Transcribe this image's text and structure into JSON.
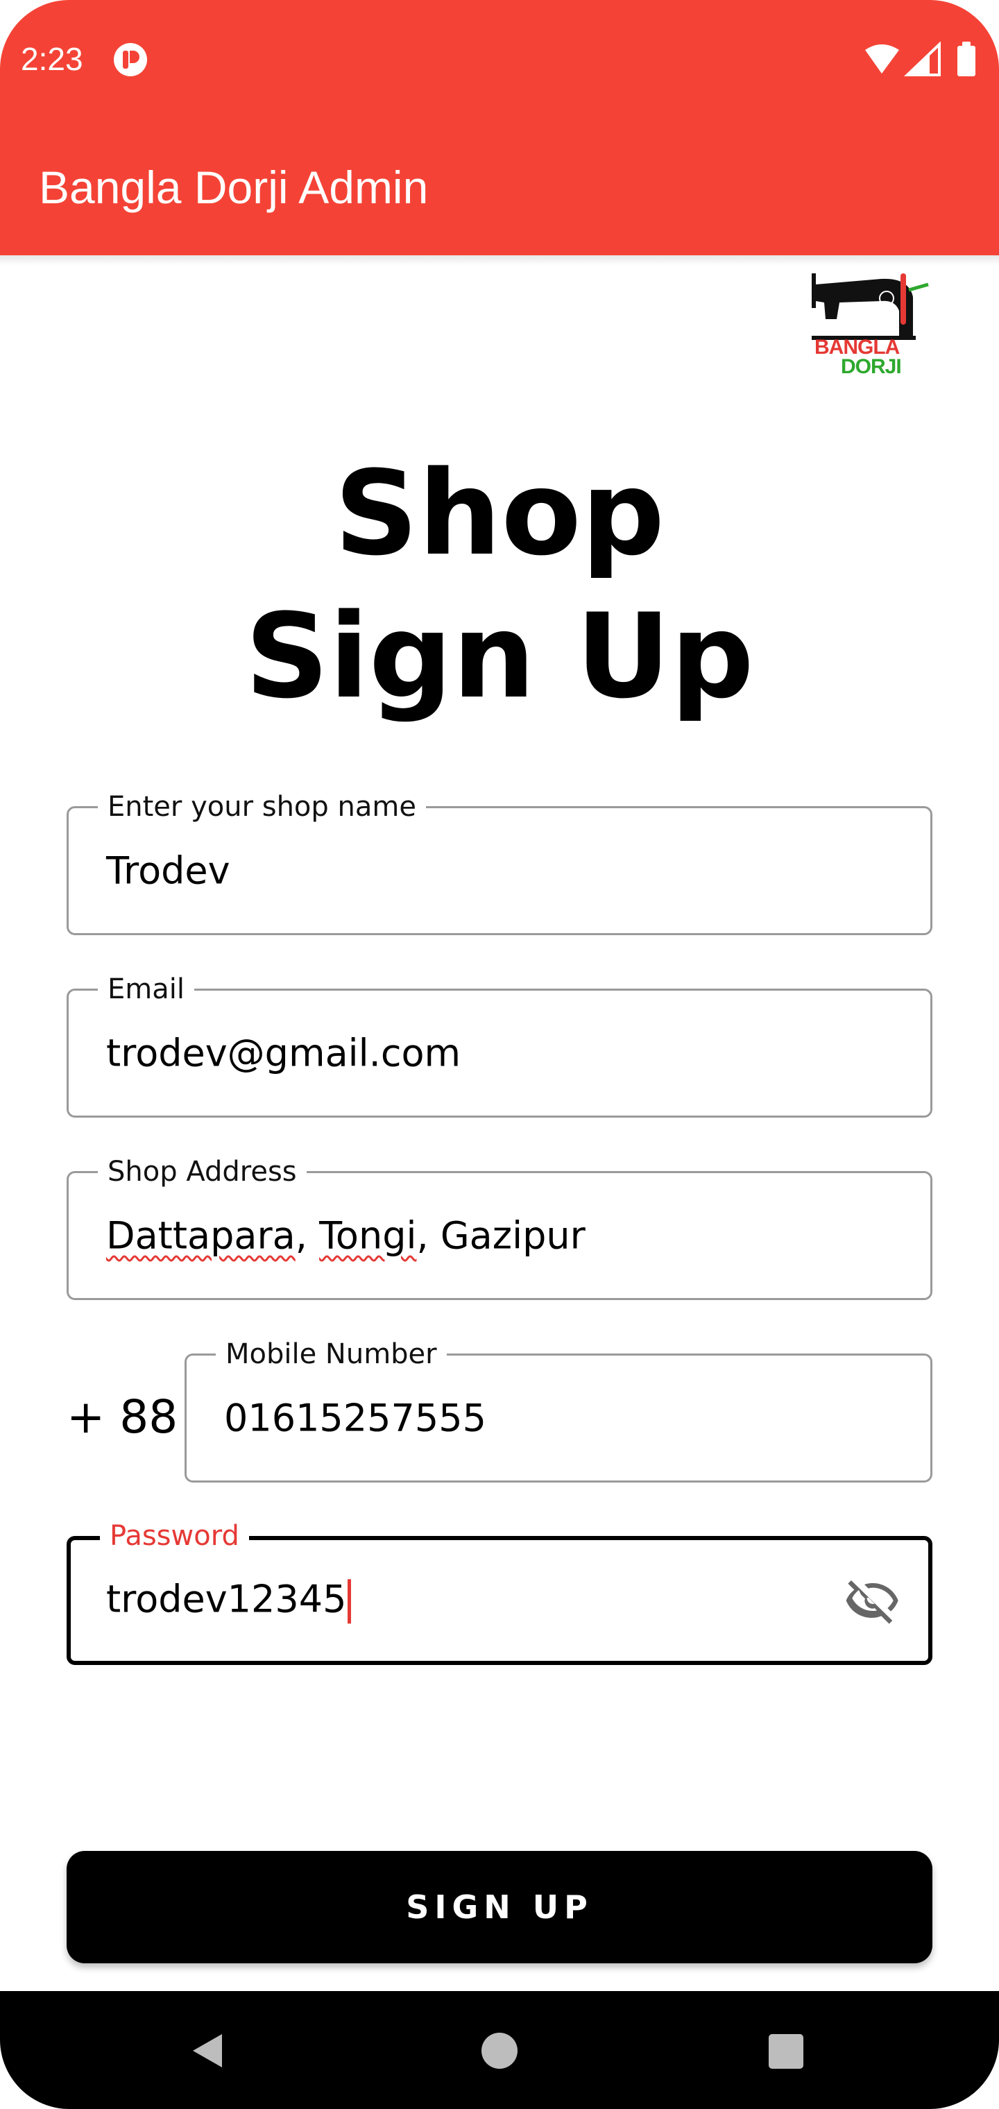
{
  "status_bar": {
    "time": "2:23"
  },
  "app_bar": {
    "title": "Bangla Dorji Admin",
    "color": "#F44336"
  },
  "logo": {
    "line1": "BANGLA",
    "line2": "DORJI"
  },
  "heading": {
    "line1": "Shop",
    "line2": "Sign Up"
  },
  "form": {
    "shop_name": {
      "label": "Enter your shop name",
      "value": "Trodev"
    },
    "email": {
      "label": "Email",
      "value": "trodev@gmail.com"
    },
    "address": {
      "label": "Shop Address",
      "value_part1": "Dattapara",
      "sep1": ", ",
      "value_part2": "Tongi",
      "sep2": ", ",
      "value_part3": "Gazipur"
    },
    "mobile": {
      "prefix": "+ 88",
      "label": "Mobile Number",
      "value": "01615257555"
    },
    "password": {
      "label": "Password",
      "value": "trodev12345",
      "toggle_icon": "eye-off-icon"
    }
  },
  "sign_up_button": {
    "label": "SIGN UP"
  },
  "nav_bar": {
    "icons": [
      "back-icon",
      "home-icon",
      "recents-icon"
    ]
  }
}
